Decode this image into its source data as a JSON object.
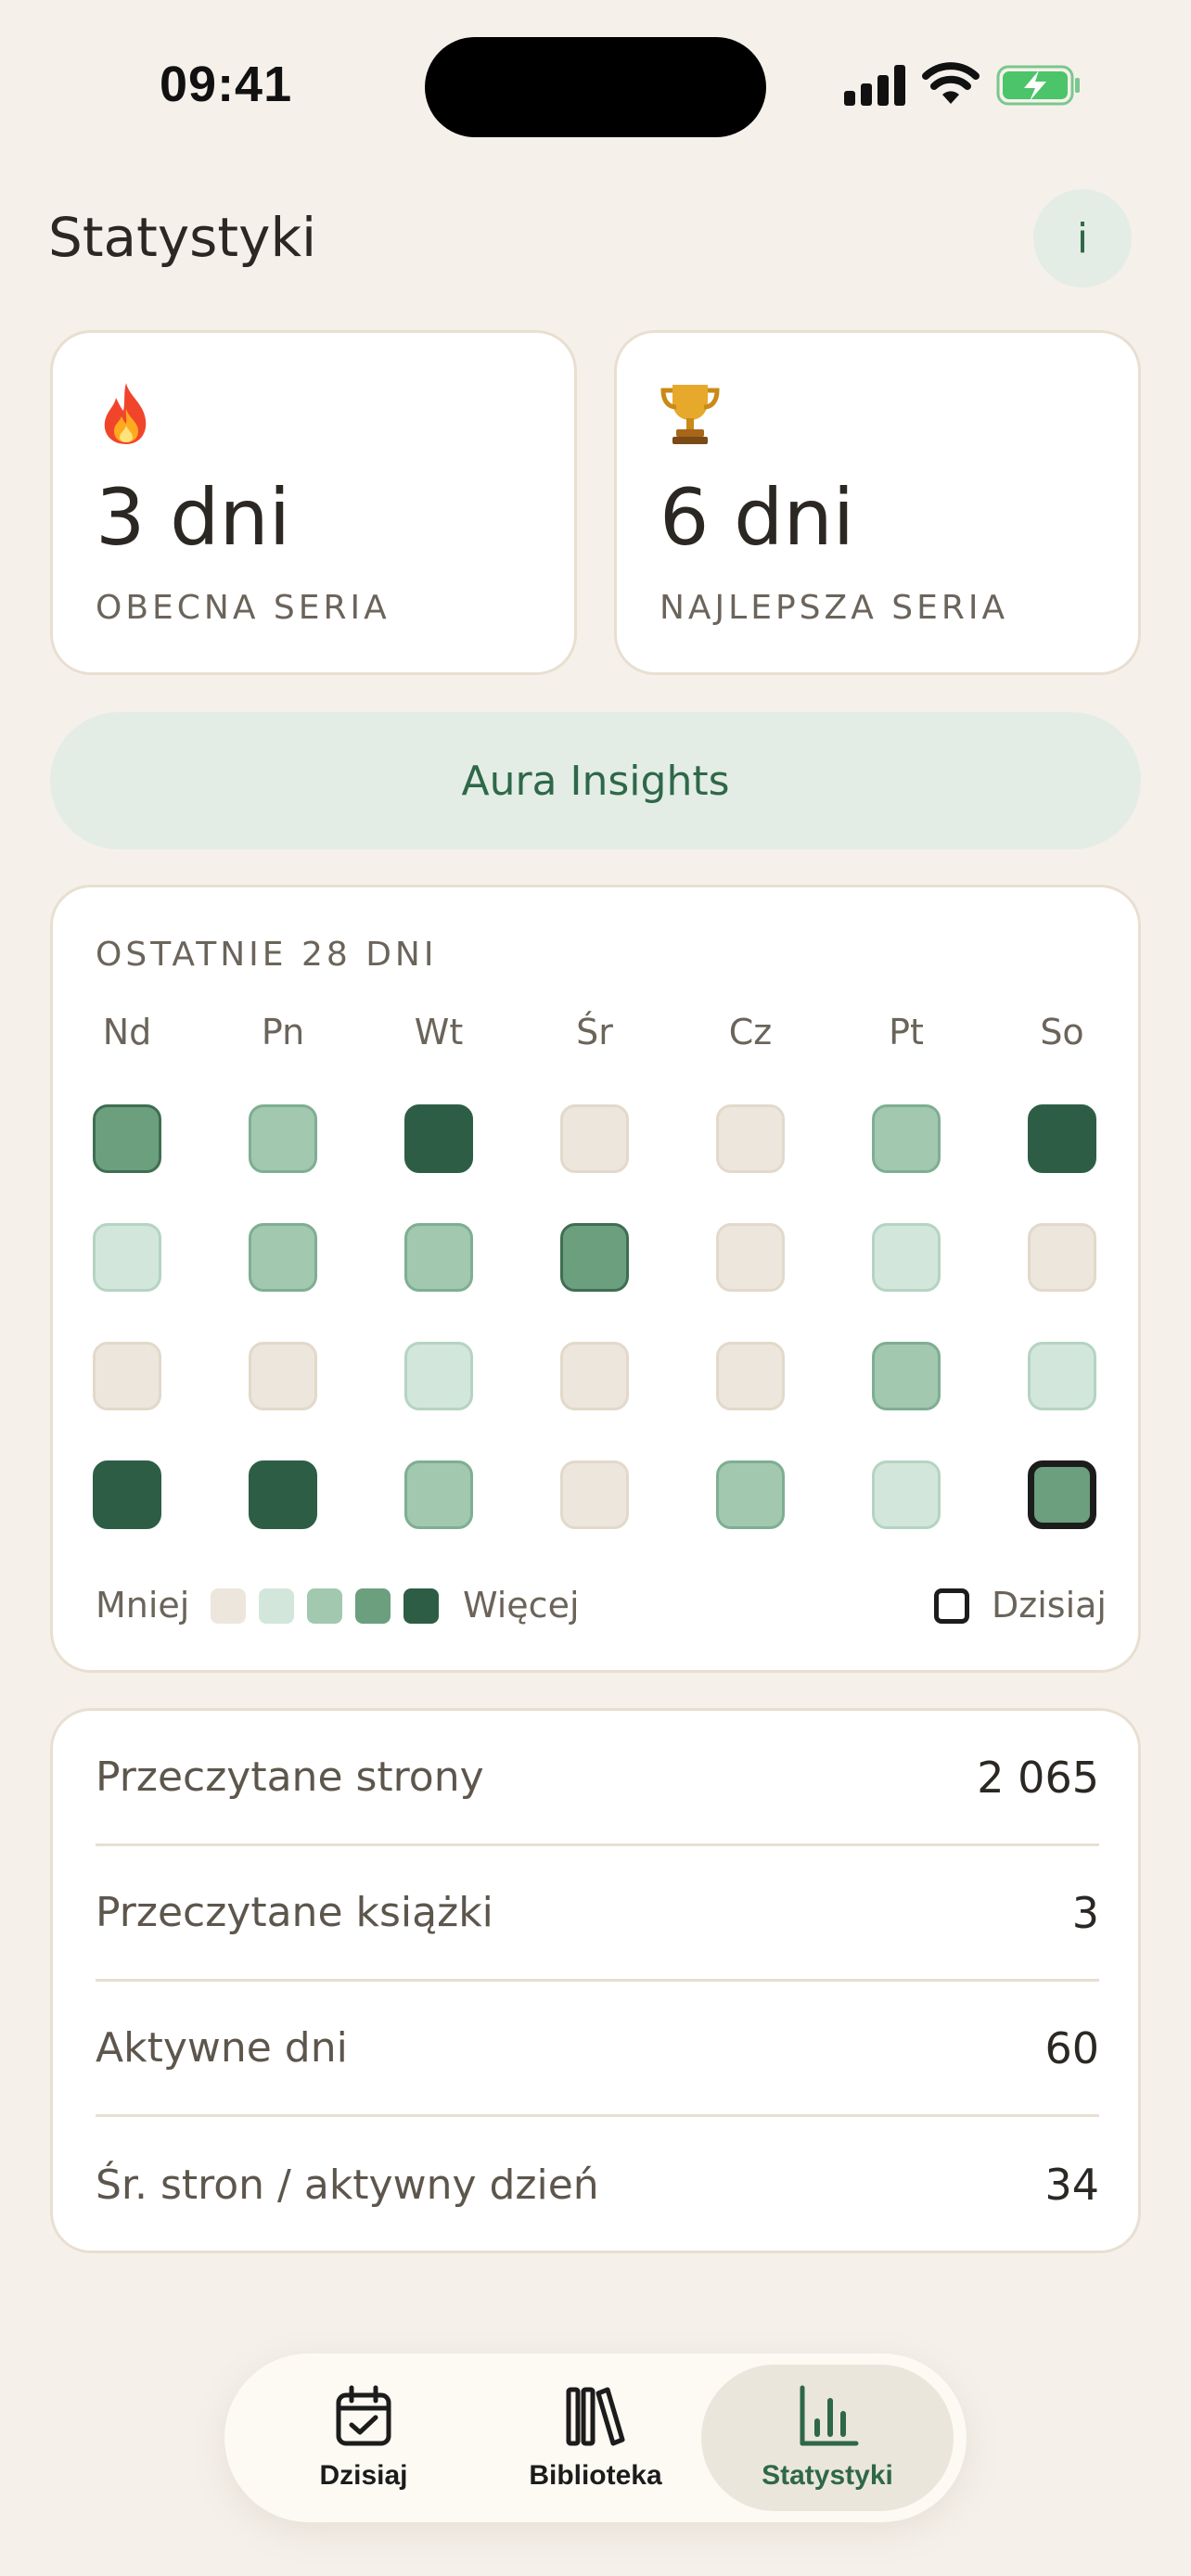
{
  "status_bar": {
    "time": "09:41"
  },
  "header": {
    "title": "Statystyki",
    "info_label": "i"
  },
  "streaks": [
    {
      "icon": "fire-icon",
      "value": "3 dni",
      "label": "OBECNA SERIA"
    },
    {
      "icon": "trophy-icon",
      "value": "6 dni",
      "label": "NAJLEPSZA SERIA"
    }
  ],
  "insights": {
    "label": "Aura Insights"
  },
  "heatmap": {
    "title": "OSTATNIE 28 DNI",
    "days": [
      "Nd",
      "Pn",
      "Wt",
      "Śr",
      "Cz",
      "Pt",
      "So"
    ],
    "levels": [
      [
        3,
        2,
        4,
        0,
        0,
        2,
        4
      ],
      [
        1,
        2,
        2,
        3,
        0,
        1,
        0
      ],
      [
        0,
        0,
        1,
        0,
        0,
        2,
        1
      ],
      [
        4,
        4,
        2,
        0,
        2,
        1,
        3
      ]
    ],
    "today": {
      "row": 3,
      "col": 6
    },
    "legend_less": "Mniej",
    "legend_more": "Więcej",
    "legend_today": "Dzisiaj",
    "colors": [
      "#ede6dc",
      "#d3e6dc",
      "#a2c8b0",
      "#6b9f7e",
      "#2d5e45"
    ]
  },
  "stats": [
    {
      "label": "Przeczytane strony",
      "value": "2 065"
    },
    {
      "label": "Przeczytane książki",
      "value": "3"
    },
    {
      "label": "Aktywne dni",
      "value": "60"
    },
    {
      "label": "Śr. stron / aktywny dzień",
      "value": "34"
    }
  ],
  "tabbar": {
    "tabs": [
      {
        "label": "Dzisiaj",
        "icon": "calendar-check-icon"
      },
      {
        "label": "Biblioteka",
        "icon": "books-icon"
      },
      {
        "label": "Statystyki",
        "icon": "bar-chart-icon",
        "active": true
      }
    ]
  },
  "accent_color": "#2e6848"
}
